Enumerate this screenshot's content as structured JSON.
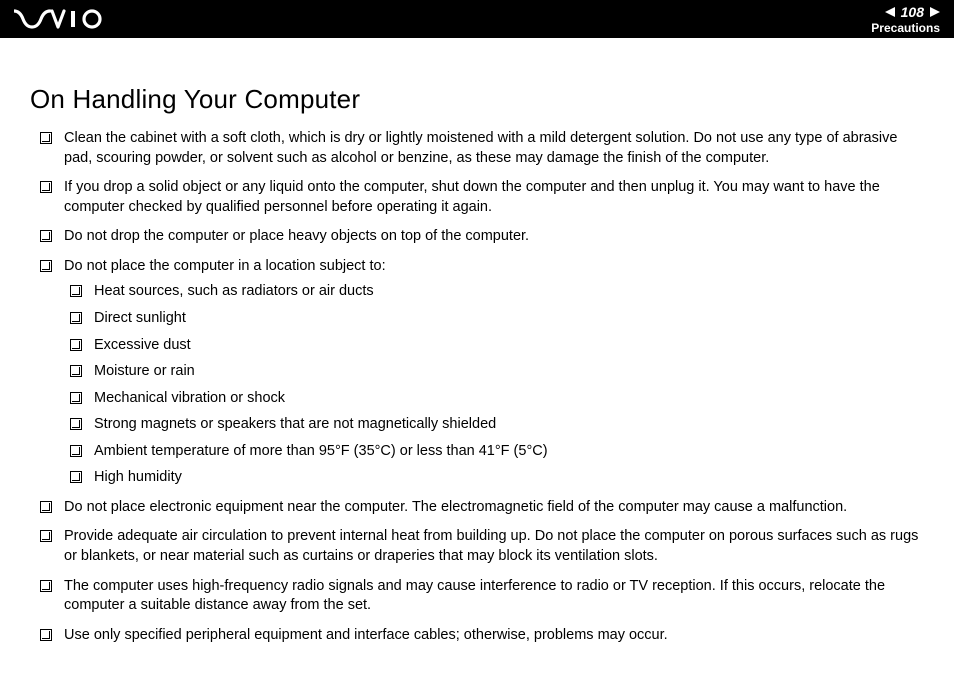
{
  "header": {
    "page_number": "108",
    "section": "Precautions"
  },
  "title": "On Handling Your Computer",
  "items": [
    {
      "text": "Clean the cabinet with a soft cloth, which is dry or lightly moistened with a mild detergent solution. Do not use any type of abrasive pad, scouring powder, or solvent such as alcohol or benzine, as these may damage the finish of the computer."
    },
    {
      "text": "If you drop a solid object or any liquid onto the computer, shut down the computer and then unplug it. You may want to have the computer checked by qualified personnel before operating it again."
    },
    {
      "text": "Do not drop the computer or place heavy objects on top of the computer."
    },
    {
      "text": "Do not place the computer in a location subject to:",
      "sub": [
        "Heat sources, such as radiators or air ducts",
        "Direct sunlight",
        "Excessive dust",
        "Moisture or rain",
        "Mechanical vibration or shock",
        "Strong magnets or speakers that are not magnetically shielded",
        "Ambient temperature of more than 95°F (35°C) or less than 41°F (5°C)",
        "High humidity"
      ]
    },
    {
      "text": "Do not place electronic equipment near the computer. The electromagnetic field of the computer may cause a malfunction."
    },
    {
      "text": "Provide adequate air circulation to prevent internal heat from building up. Do not place the computer on porous surfaces such as rugs or blankets, or near material such as curtains or draperies that may block its ventilation slots."
    },
    {
      "text": "The computer uses high-frequency radio signals and may cause interference to radio or TV reception. If this occurs, relocate the computer a suitable distance away from the set."
    },
    {
      "text": "Use only specified peripheral equipment and interface cables; otherwise, problems may occur."
    }
  ]
}
